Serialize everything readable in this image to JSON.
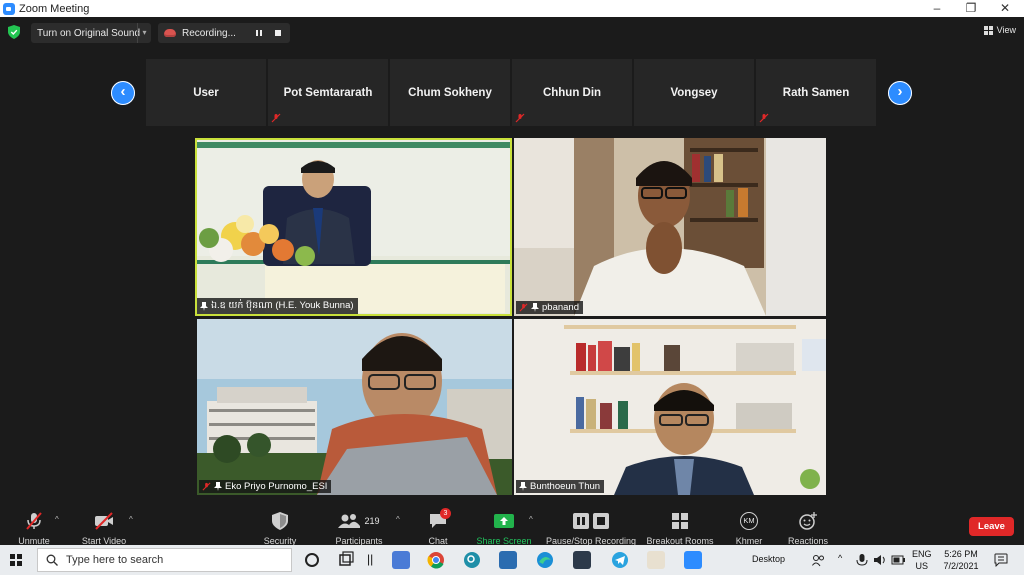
{
  "window": {
    "title": "Zoom Meeting",
    "minimize": "–",
    "restore": "❐",
    "close": "✕"
  },
  "topbar": {
    "original_sound": "Turn on Original Sound",
    "recording": "Recording...",
    "view": "View"
  },
  "participants_strip": {
    "prev": "‹",
    "next": "›",
    "names": [
      "User",
      "Pot Semtararath",
      "Chum Sokheny",
      "Chhun Din",
      "Vongsey",
      "Rath Samen"
    ]
  },
  "videos": {
    "tile1": "ឯ.ឧ យក់ ប៊ុនណា (H.E. Youk Bunna)",
    "tile2": "pbanand",
    "tile3": "Eko Priyo Purnomo_ESI",
    "tile4": "Bunthoeun Thun"
  },
  "toolbar": {
    "unmute": "Unmute",
    "start_video": "Start Video",
    "security": "Security",
    "participants": "Participants",
    "participants_count": "219",
    "chat": "Chat",
    "chat_badge": "3",
    "share_screen": "Share Screen",
    "pause_stop": "Pause/Stop Recording",
    "breakout": "Breakout Rooms",
    "khmer": "Khmer",
    "khmer_initials": "KM",
    "reactions": "Reactions",
    "leave": "Leave"
  },
  "taskbar": {
    "search_placeholder": "Type here to search",
    "desktop": "Desktop",
    "lang_top": "ENG",
    "lang_bottom": "US",
    "time": "5:26 PM",
    "date": "7/2/2021"
  },
  "colors": {
    "zoom_blue": "#2d8cff",
    "leave_red": "#e02828",
    "share_green": "#22b34c",
    "speaker_outline": "#c9e03b"
  }
}
